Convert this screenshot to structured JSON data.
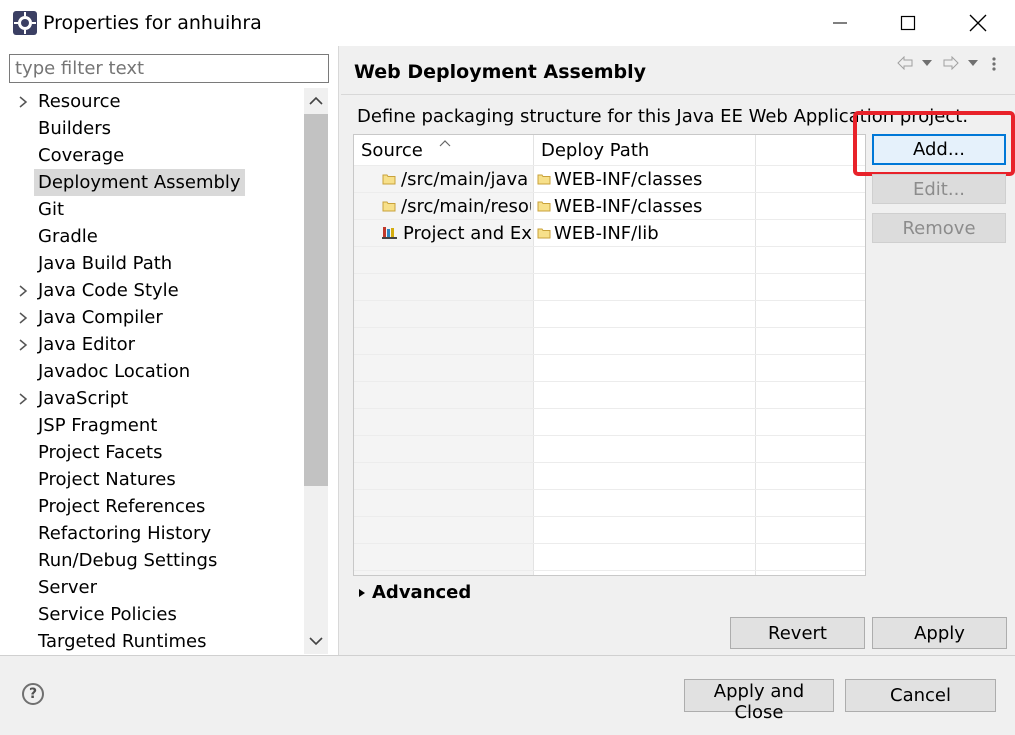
{
  "window": {
    "title": "Properties for anhuihra"
  },
  "filter": {
    "placeholder": "type filter text"
  },
  "tree": {
    "items": [
      {
        "label": "Resource",
        "expandable": true
      },
      {
        "label": "Builders",
        "expandable": false
      },
      {
        "label": "Coverage",
        "expandable": false
      },
      {
        "label": "Deployment Assembly",
        "expandable": false,
        "selected": true
      },
      {
        "label": "Git",
        "expandable": false
      },
      {
        "label": "Gradle",
        "expandable": false
      },
      {
        "label": "Java Build Path",
        "expandable": false
      },
      {
        "label": "Java Code Style",
        "expandable": true
      },
      {
        "label": "Java Compiler",
        "expandable": true
      },
      {
        "label": "Java Editor",
        "expandable": true
      },
      {
        "label": "Javadoc Location",
        "expandable": false
      },
      {
        "label": "JavaScript",
        "expandable": true
      },
      {
        "label": "JSP Fragment",
        "expandable": false
      },
      {
        "label": "Project Facets",
        "expandable": false
      },
      {
        "label": "Project Natures",
        "expandable": false
      },
      {
        "label": "Project References",
        "expandable": false
      },
      {
        "label": "Refactoring History",
        "expandable": false
      },
      {
        "label": "Run/Debug Settings",
        "expandable": false
      },
      {
        "label": "Server",
        "expandable": false
      },
      {
        "label": "Service Policies",
        "expandable": false
      },
      {
        "label": "Targeted Runtimes",
        "expandable": false
      }
    ]
  },
  "page": {
    "title": "Web Deployment Assembly",
    "description": "Define packaging structure for this Java EE Web Application project."
  },
  "table": {
    "columns": [
      "Source",
      "Deploy Path"
    ],
    "rows": [
      {
        "source": "/src/main/java",
        "source_icon": "folder-icon",
        "deploy": "WEB-INF/classes"
      },
      {
        "source": "/src/main/resources",
        "source_icon": "folder-icon",
        "deploy": "WEB-INF/classes"
      },
      {
        "source": "Project and External Dependencies",
        "source_icon": "library-icon",
        "deploy": "WEB-INF/lib"
      }
    ]
  },
  "buttons": {
    "add": "Add...",
    "edit": "Edit...",
    "remove": "Remove",
    "revert": "Revert",
    "apply": "Apply",
    "apply_close": "Apply and Close",
    "cancel": "Cancel"
  },
  "advanced": {
    "label": "Advanced"
  },
  "help": {
    "glyph": "?"
  },
  "colors": {
    "highlight": "#e8222a",
    "selection": "#d9d9d9",
    "focus": "#0078d7"
  }
}
